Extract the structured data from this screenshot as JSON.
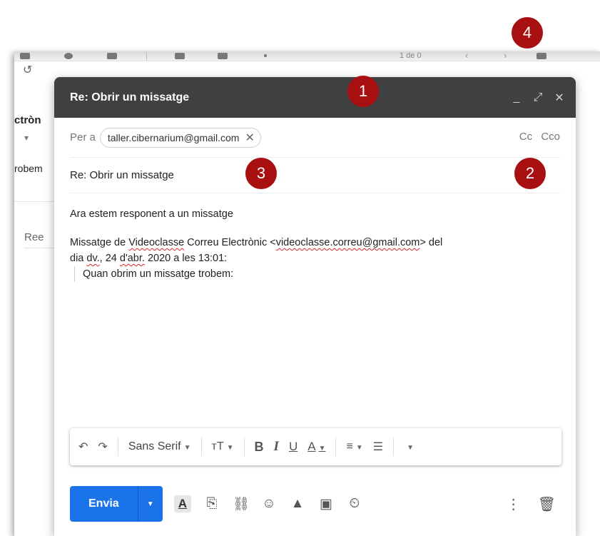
{
  "background": {
    "page_count": "1 de 0",
    "partial_text_1": "ctròn",
    "partial_text_2": "robem",
    "partial_text_3": "Ree"
  },
  "compose": {
    "title": "Re: Obrir un missatge",
    "controls": {
      "minimize": "_",
      "expand": "⤢",
      "close": "✕"
    },
    "to_label": "Per a",
    "recipient": "taller.cibernarium@gmail.com",
    "cc_label": "Cc",
    "bcc_label": "Cco",
    "subject": "Re: Obrir un missatge",
    "body": {
      "line1": "Ara estem responent a un missatge",
      "quote_intro_a": "Missatge de ",
      "quote_intro_sender_word": "Videoclasse",
      "quote_intro_b": " Correu Electrònic <",
      "quote_email": "videoclasse.correu@gmail.com",
      "quote_intro_c": "> del",
      "quote_date_a": "dia ",
      "quote_date_day": "dv.",
      "quote_date_b": ", 24 ",
      "quote_date_month": "d'abr.",
      "quote_date_c": " 2020 a les 13:01:",
      "quoted_text": "Quan obrim un missatge trobem:"
    },
    "formatting": {
      "font": "Sans Serif",
      "bold": "B",
      "italic": "I",
      "underline": "U",
      "text_color": "A"
    },
    "send_label": "Envia"
  },
  "callouts": [
    "1",
    "2",
    "3",
    "4"
  ],
  "colors": {
    "header_bg": "#404040",
    "send_blue": "#1a73e8",
    "callout_red": "#a80f10"
  }
}
